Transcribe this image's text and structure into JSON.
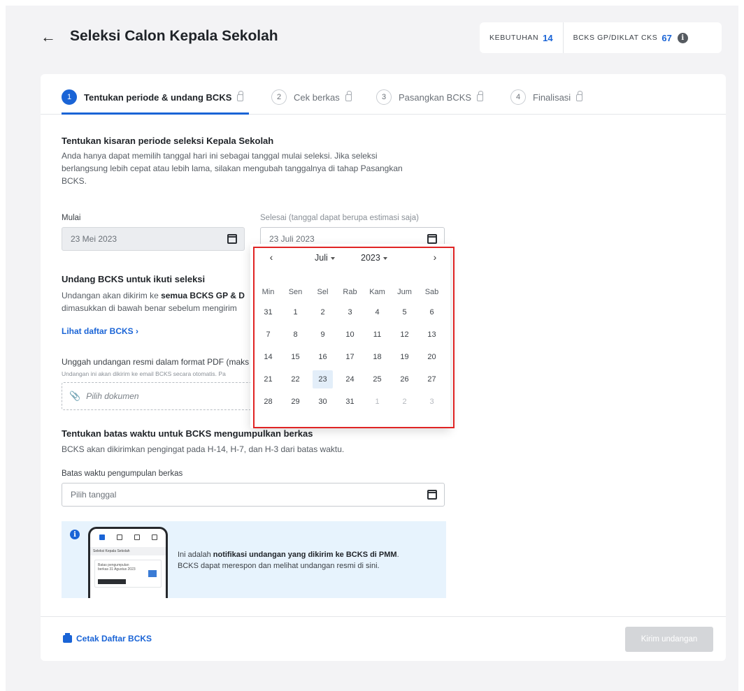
{
  "header": {
    "title": "Seleksi Calon Kepala Sekolah",
    "stats": [
      {
        "label": "KEBUTUHAN",
        "value": "14"
      },
      {
        "label": "BCKS GP/DIKLAT CKS",
        "value": "67"
      }
    ]
  },
  "steps": [
    {
      "num": "1",
      "label": "Tentukan periode & undang BCKS"
    },
    {
      "num": "2",
      "label": "Cek berkas"
    },
    {
      "num": "3",
      "label": "Pasangkan BCKS"
    },
    {
      "num": "4",
      "label": "Finalisasi"
    }
  ],
  "period": {
    "title": "Tentukan kisaran periode seleksi Kepala Sekolah",
    "desc": "Anda hanya dapat memilih tanggal hari ini sebagai tanggal mulai seleksi. Jika seleksi berlangsung lebih cepat atau lebih lama, silakan mengubah tanggalnya di tahap Pasangkan BCKS.",
    "start_label": "Mulai",
    "start_value": "23 Mei 2023",
    "end_label": "Selesai (tanggal dapat berupa estimasi saja)",
    "end_value": "23 Juli 2023"
  },
  "invite": {
    "title": "Undang BCKS untuk ikuti seleksi",
    "desc_prefix": "Undangan akan dikirim ke ",
    "desc_bold": "semua BCKS GP & D",
    "desc_line2": "dimasukkan di bawah benar sebelum mengirim",
    "list_link": "Lihat daftar BCKS",
    "upload_label": "Unggah undangan resmi dalam format PDF (maks",
    "upload_note": "Undangan ini akan dikirim ke email BCKS secara otomatis. Pa",
    "upload_placeholder": "Pilih dokumen"
  },
  "deadline": {
    "title": "Tentukan batas waktu untuk BCKS mengumpulkan berkas",
    "desc": "BCKS akan dikirimkan pengingat pada H-14, H-7, dan H-3 dari batas waktu.",
    "label": "Batas waktu pengumpulan berkas",
    "placeholder": "Pilih tanggal"
  },
  "notice": {
    "prefix": "Ini adalah ",
    "bold": "notifikasi undangan yang dikirim ke BCKS di PMM",
    "suffix": ".",
    "line2": "BCKS dapat merespon dan melihat undangan resmi di sini.",
    "phone_header": "Seleksi Kepala Sekolah",
    "phone_card": "Batas pengumpulan berkas 31 Agustus 2023"
  },
  "footer": {
    "print_label": "Cetak Daftar BCKS",
    "send_label": "Kirim undangan"
  },
  "datepicker": {
    "month": "Juli",
    "year": "2023",
    "dows": [
      "Min",
      "Sen",
      "Sel",
      "Rab",
      "Kam",
      "Jum",
      "Sab"
    ],
    "days": [
      {
        "d": "31",
        "out": false
      },
      {
        "d": "1",
        "out": false
      },
      {
        "d": "2",
        "out": false
      },
      {
        "d": "3",
        "out": false
      },
      {
        "d": "4",
        "out": false
      },
      {
        "d": "5",
        "out": false
      },
      {
        "d": "6",
        "out": false
      },
      {
        "d": "7",
        "out": false
      },
      {
        "d": "8",
        "out": false
      },
      {
        "d": "9",
        "out": false
      },
      {
        "d": "10",
        "out": false
      },
      {
        "d": "11",
        "out": false
      },
      {
        "d": "12",
        "out": false
      },
      {
        "d": "13",
        "out": false
      },
      {
        "d": "14",
        "out": false
      },
      {
        "d": "15",
        "out": false
      },
      {
        "d": "16",
        "out": false
      },
      {
        "d": "17",
        "out": false
      },
      {
        "d": "18",
        "out": false
      },
      {
        "d": "19",
        "out": false
      },
      {
        "d": "20",
        "out": false
      },
      {
        "d": "21",
        "out": false
      },
      {
        "d": "22",
        "out": false
      },
      {
        "d": "23",
        "out": false,
        "selected": true
      },
      {
        "d": "24",
        "out": false
      },
      {
        "d": "25",
        "out": false
      },
      {
        "d": "26",
        "out": false
      },
      {
        "d": "27",
        "out": false
      },
      {
        "d": "28",
        "out": false
      },
      {
        "d": "29",
        "out": false
      },
      {
        "d": "30",
        "out": false
      },
      {
        "d": "31",
        "out": false
      },
      {
        "d": "1",
        "out": true
      },
      {
        "d": "2",
        "out": true
      },
      {
        "d": "3",
        "out": true
      }
    ]
  },
  "colors": {
    "primary": "#1a64d6",
    "highlight": "#e02424",
    "notice_bg": "#e7f3fd"
  }
}
